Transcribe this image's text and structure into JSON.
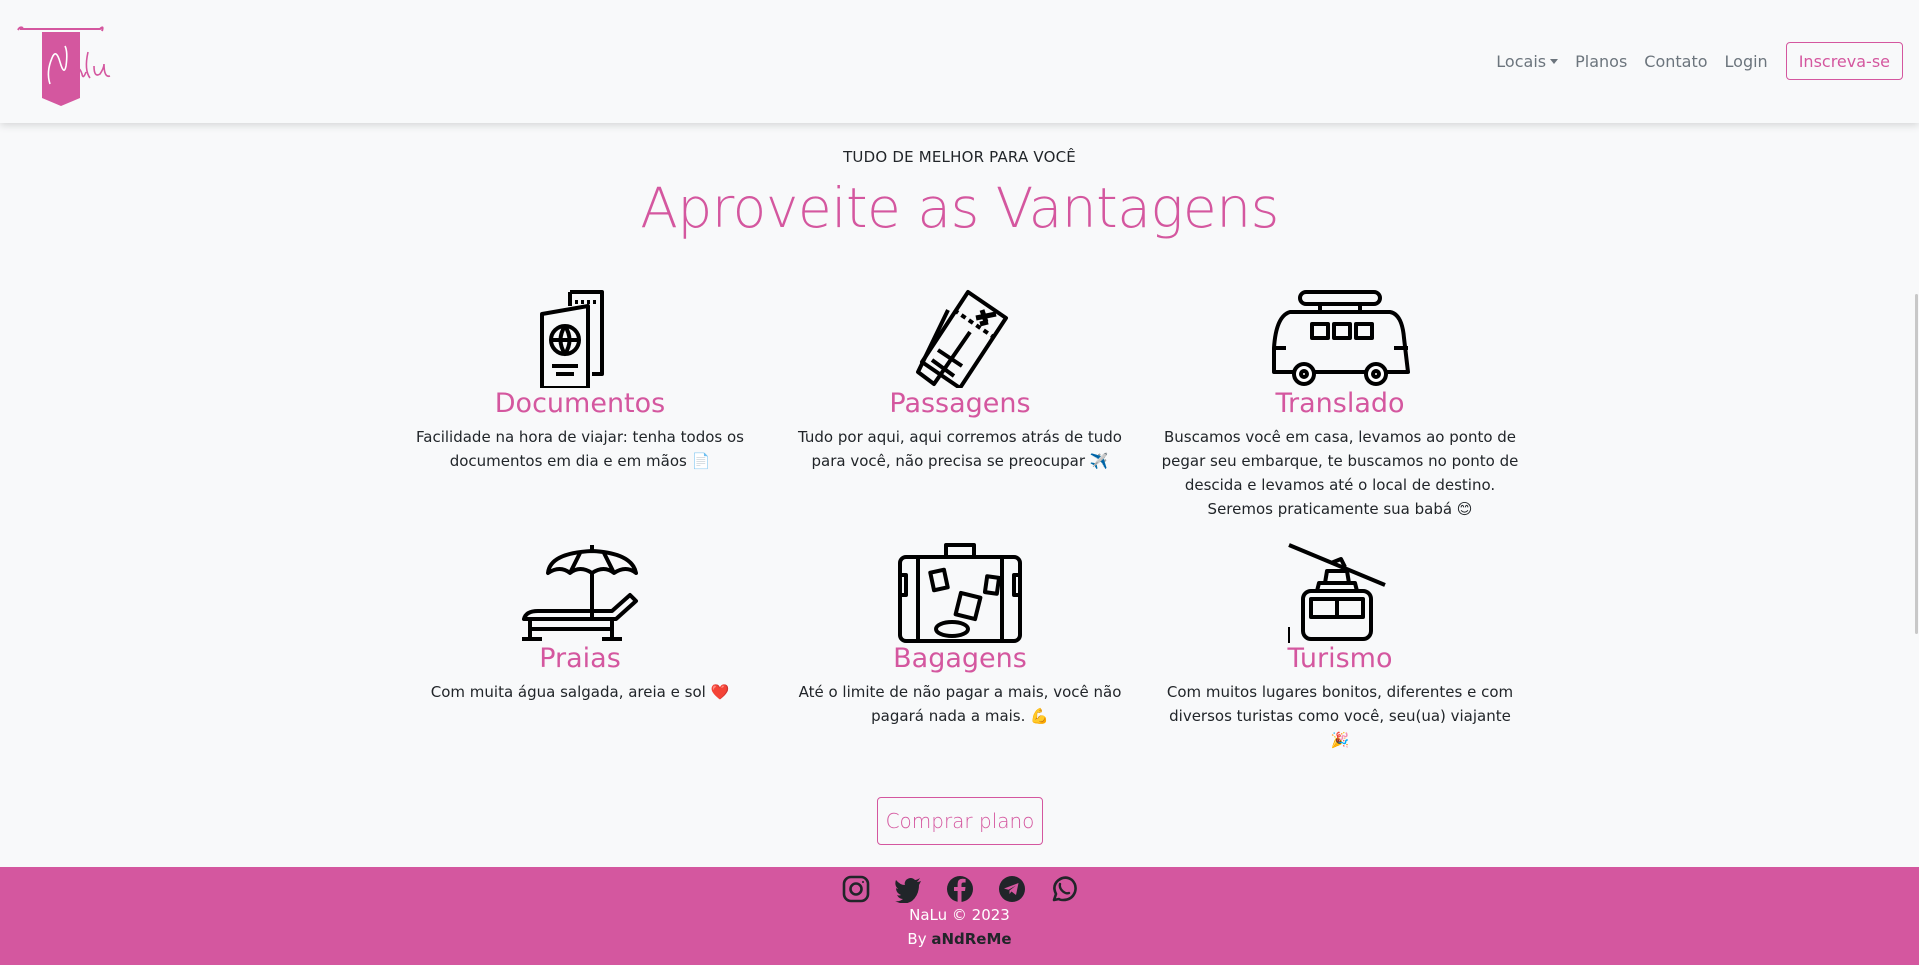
{
  "brand": {
    "name": "Nalu",
    "color": "#d4579f"
  },
  "nav": {
    "locais": "Locais",
    "planos": "Planos",
    "contato": "Contato",
    "login": "Login",
    "signup": "Inscreva-se"
  },
  "hero": {
    "eyebrow": "TUDO DE MELHOR PARA VOCÊ",
    "title": "Aproveite as Vantagens"
  },
  "features": [
    {
      "icon": "passport-icon",
      "title": "Documentos",
      "text": "Facilidade na hora de viajar: tenha todos os documentos em dia e em mãos 📄"
    },
    {
      "icon": "tickets-icon",
      "title": "Passagens",
      "text": "Tudo por aqui, aqui corremos atrás de tudo para você, não precisa se preocupar ✈️"
    },
    {
      "icon": "van-icon",
      "title": "Translado",
      "text": "Buscamos você em casa, levamos ao ponto de pegar seu embarque, te buscamos no ponto de descida e levamos até o local de destino. Seremos praticamente sua babá 😊"
    },
    {
      "icon": "beach-chair-icon",
      "title": "Praias",
      "text": "Com muita água salgada, areia e sol ❤️"
    },
    {
      "icon": "suitcase-icon",
      "title": "Bagagens",
      "text": "Até o limite de não pagar a mais, você não pagará nada a mais. 💪"
    },
    {
      "icon": "cable-car-icon",
      "title": "Turismo",
      "text": "Com muitos lugares bonitos, diferentes e com diversos turistas como você, seu(ua) viajante 🎉"
    }
  ],
  "cta": {
    "label": "Comprar plano"
  },
  "footer": {
    "socials": [
      "instagram-icon",
      "twitter-icon",
      "facebook-icon",
      "telegram-icon",
      "whatsapp-icon"
    ],
    "copyright": "NaLu © 2023",
    "by": "By ",
    "author": "aNdReMe"
  }
}
